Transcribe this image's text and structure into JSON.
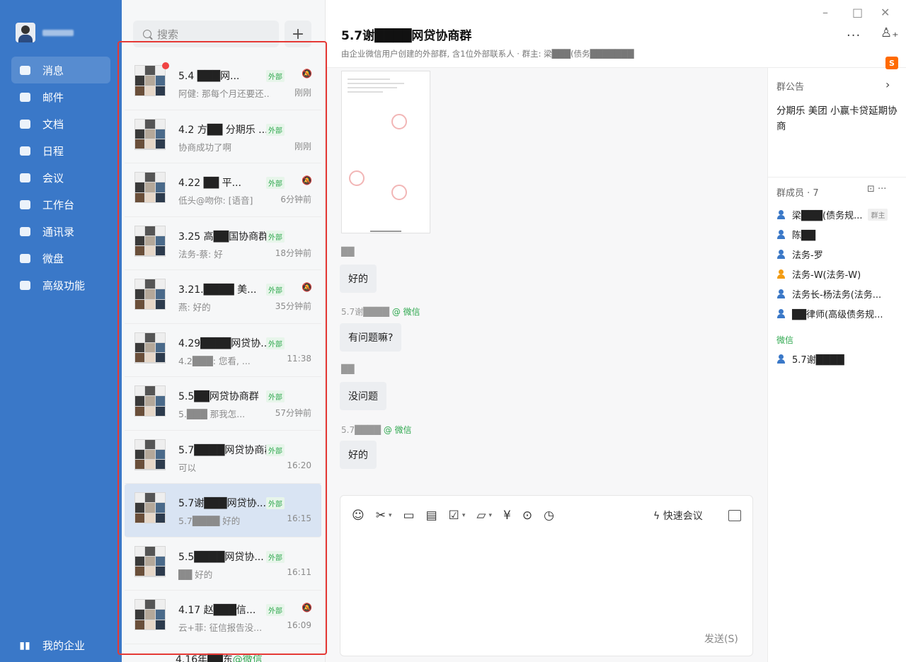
{
  "nav": {
    "user_name_blur": "",
    "items": [
      {
        "label": "消息",
        "icon": "message-icon"
      },
      {
        "label": "邮件",
        "icon": "mail-icon"
      },
      {
        "label": "文档",
        "icon": "document-icon"
      },
      {
        "label": "日程",
        "icon": "calendar-icon"
      },
      {
        "label": "会议",
        "icon": "meeting-icon"
      },
      {
        "label": "工作台",
        "icon": "workbench-icon"
      },
      {
        "label": "通讯录",
        "icon": "contacts-icon"
      },
      {
        "label": "微盘",
        "icon": "drive-icon"
      },
      {
        "label": "高级功能",
        "icon": "advanced-icon"
      }
    ],
    "bottom_label": "我的企业",
    "accent": "#3a78c8"
  },
  "list": {
    "search_placeholder": "搜索",
    "add_label": "+",
    "external_label": "外部",
    "conversations": [
      {
        "title": "5.4 ███网...",
        "preview": "阿健: 那每个月还要还...",
        "time": "刚刚"
      },
      {
        "title": "4.2 方██ 分期乐 ...",
        "preview": "协商成功了啊",
        "time": "刚刚"
      },
      {
        "title": "4.22 ██ 平...",
        "preview": "低头@吻你: [语音]",
        "time": "6分钟前"
      },
      {
        "title": "3.25 高██国协商群",
        "preview": "法务-蔡: 好",
        "time": "18分钟前"
      },
      {
        "title": "3.21.████ 美...",
        "preview": "燕: 好的",
        "time": "35分钟前"
      },
      {
        "title": "4.29████网贷协...",
        "preview": "4.2███: 您看, ...",
        "time": "11:38"
      },
      {
        "title": "5.5██网贷协商群",
        "preview": "5.███ 那我怎...",
        "time": "57分钟前"
      },
      {
        "title": "5.7████网贷协商群",
        "preview": "可以",
        "time": "16:20"
      },
      {
        "title": "5.7谢███网贷协...",
        "preview": "5.7████ 好的",
        "time": "16:15"
      },
      {
        "title": "5.5████网贷协...",
        "preview": "██ 好的",
        "time": "16:11"
      },
      {
        "title": "4.17 赵███信...",
        "preview": "云+菲: 征信报告没...",
        "time": "16:09"
      }
    ],
    "peek_title": "4.16年██东",
    "peek_wechat": "@微信"
  },
  "chat": {
    "title": "5.7谢████网贷协商群",
    "subtitle": "由企业微信用户创建的外部群, 含1位外部联系人 · 群主: 梁███(债务███████",
    "more": "···",
    "messages": [
      {
        "sender": "██",
        "wechat": "",
        "text": "好的"
      },
      {
        "sender": "5.7谢████",
        "wechat": "@ 微信",
        "text": "有问题嘛?"
      },
      {
        "sender": "██",
        "wechat": "",
        "text": "没问题"
      },
      {
        "sender": "5.7████",
        "wechat": "@ 微信",
        "text": "好的"
      }
    ],
    "quick_meeting": "快速会议",
    "send_label": "发送(S)",
    "window": {
      "minimize": "–",
      "maximize": "□",
      "close": "✕"
    }
  },
  "side": {
    "notice_title": "群公告",
    "notice_text": "分期乐 美团 小赢卡贷延期协商",
    "members_title": "群成员 · 7",
    "members": [
      {
        "name": "梁███(债务规...",
        "owner": "群主"
      },
      {
        "name": "陈██",
        "owner": ""
      },
      {
        "name": "法务-罗",
        "owner": ""
      },
      {
        "name": "法务-W(法务-W)",
        "owner": ""
      },
      {
        "name": "法务长-杨法务(法务...",
        "owner": ""
      },
      {
        "name": "██律师(高级债务规...",
        "owner": ""
      }
    ],
    "wechat_header": "微信",
    "wechat_member": "5.7谢████",
    "badge": "S"
  }
}
